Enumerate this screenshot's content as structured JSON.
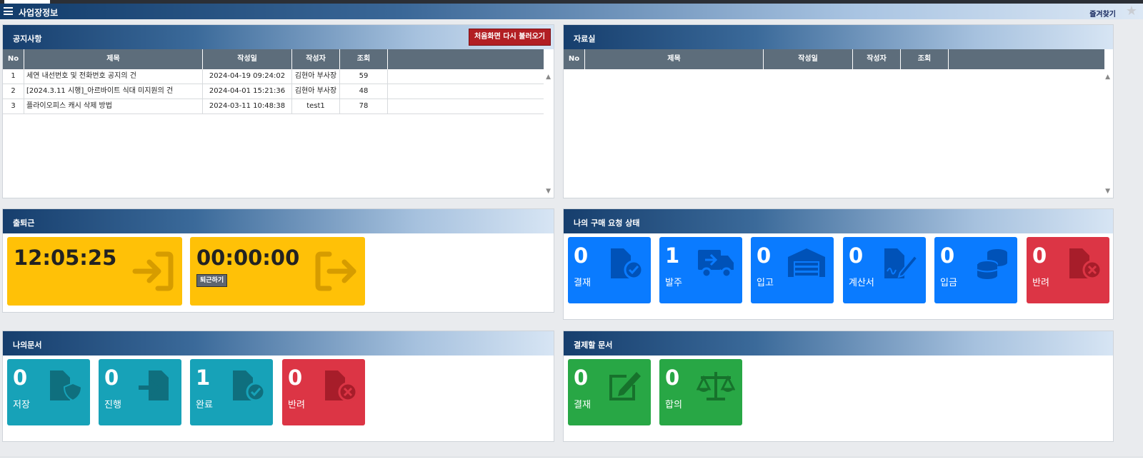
{
  "app": {
    "title": "사업장정보",
    "favorites_label": "즐겨찾기"
  },
  "notice": {
    "title": "공지사항",
    "reload_label": "처음화면 다시 불러오기",
    "columns": [
      "No",
      "제목",
      "작성일",
      "작성자",
      "조회"
    ],
    "rows": [
      {
        "no": "1",
        "subject": "세연 내선번호 및 전화번호 공지의 건",
        "date": "2024-04-19 09:24:02",
        "author": "김현아 부사장",
        "views": "59"
      },
      {
        "no": "2",
        "subject": "[2024.3.11 시행]_아르바이트 식대 미지원의 건",
        "date": "2024-04-01 15:21:36",
        "author": "김현아 부사장",
        "views": "48"
      },
      {
        "no": "3",
        "subject": "플라이오피스 캐시 삭제 방법",
        "date": "2024-03-11 10:48:38",
        "author": "test1",
        "views": "78"
      }
    ]
  },
  "archive": {
    "title": "자료실",
    "columns": [
      "No",
      "제목",
      "작성일",
      "작성자",
      "조회"
    ]
  },
  "attendance": {
    "title": "출퇴근",
    "clock_in_time": "12:05:25",
    "clock_out_time": "00:00:00",
    "clock_out_button": "퇴근하기"
  },
  "purchase": {
    "title": "나의 구매 요청 상태",
    "tiles": [
      {
        "count": "0",
        "label": "결재",
        "icon": "file-check-icon",
        "color": "#0a7bff"
      },
      {
        "count": "1",
        "label": "발주",
        "icon": "truck-icon",
        "color": "#0a7bff"
      },
      {
        "count": "0",
        "label": "입고",
        "icon": "warehouse-icon",
        "color": "#0a7bff"
      },
      {
        "count": "0",
        "label": "계산서",
        "icon": "file-signature-icon",
        "color": "#0a7bff"
      },
      {
        "count": "0",
        "label": "입금",
        "icon": "coins-icon",
        "color": "#0a7bff"
      },
      {
        "count": "0",
        "label": "반려",
        "icon": "file-reject-icon",
        "color": "#dc3545"
      }
    ]
  },
  "my_docs": {
    "title": "나의문서",
    "tiles": [
      {
        "count": "0",
        "label": "저장",
        "icon": "file-shield-icon",
        "color": "#17a2b8"
      },
      {
        "count": "0",
        "label": "진행",
        "icon": "file-import-icon",
        "color": "#17a2b8"
      },
      {
        "count": "1",
        "label": "완료",
        "icon": "file-check-icon",
        "color": "#17a2b8"
      },
      {
        "count": "0",
        "label": "반려",
        "icon": "file-reject-icon",
        "color": "#dc3545"
      }
    ]
  },
  "approval_docs": {
    "title": "결제할 문서",
    "tiles": [
      {
        "count": "0",
        "label": "결재",
        "icon": "edit-icon",
        "color": "#28a745"
      },
      {
        "count": "0",
        "label": "합의",
        "icon": "balance-scale-icon",
        "color": "#28a745"
      }
    ]
  }
}
